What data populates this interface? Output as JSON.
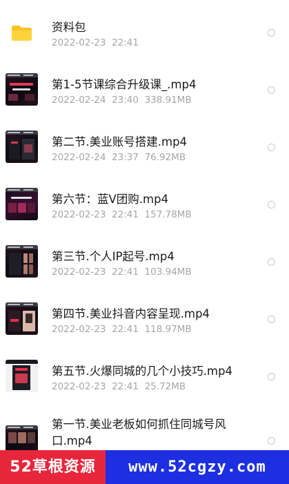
{
  "files": [
    {
      "name": "资料包",
      "date": "2022-02-23",
      "time": "22:41",
      "size": "",
      "icon": "folder-icon"
    },
    {
      "name": "第1-5节课综合升级课_.mp4",
      "date": "2022-02-24",
      "time": "23:40",
      "size": "338.91MB",
      "icon": "video-thumbnail"
    },
    {
      "name": "第二节.美业账号搭建.mp4",
      "date": "2022-02-24",
      "time": "23:37",
      "size": "76.92MB",
      "icon": "video-thumbnail"
    },
    {
      "name": "第六节：蓝V团购.mp4",
      "date": "2022-02-23",
      "time": "22:41",
      "size": "157.78MB",
      "icon": "video-thumbnail"
    },
    {
      "name": "第三节.个人IP起号.mp4",
      "date": "2022-02-23",
      "time": "22:41",
      "size": "103.94MB",
      "icon": "video-thumbnail"
    },
    {
      "name": "第四节.美业抖音内容呈现.mp4",
      "date": "2022-02-23",
      "time": "22:41",
      "size": "118.97MB",
      "icon": "video-thumbnail"
    },
    {
      "name": "第五节.火爆同城的几个小技巧.mp4",
      "date": "2022-02-23",
      "time": "22:41",
      "size": "25.72MB",
      "icon": "video-thumbnail"
    },
    {
      "name": "第一节.美业老板如何抓住同城号风口.mp4",
      "date": "",
      "time": "",
      "size": "",
      "icon": "video-thumbnail"
    }
  ],
  "watermark": {
    "left_text": "52草根资源",
    "right_text": "www.52cgzy.com",
    "left_color": "#e8263b",
    "right_color": "#1d2fe0"
  }
}
